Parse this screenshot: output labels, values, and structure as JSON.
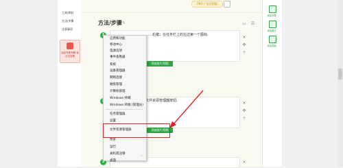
{
  "sidebar": {
    "links": [
      "工具/原料",
      "方法/步骤",
      "注意事项"
    ],
    "badge_text": "百经专属专题 请点击查看"
  },
  "topbar": {
    "ad_text": "PRO 广告位招租"
  },
  "section": {
    "title": "方法/步骤",
    "edit_icon": "✎"
  },
  "steps": [
    {
      "num": "1",
      "text": "……右键；在任务栏上的左边第一个图标:"
    },
    {
      "num": "2",
      "text": "文件资源管理器按钮;"
    },
    {
      "num": "3",
      "text": ""
    }
  ],
  "add_image_label": "添加图片/视频",
  "menu": {
    "items": [
      "应用和功能",
      "移动中心",
      "电源选项",
      "事件查看器",
      "系统",
      "设备管理器",
      "网络连接",
      "磁盘管理",
      "计算机管理",
      "Windows 终端",
      "Windows 终端 (管理员)",
      "任务管理器",
      "设置",
      "文件资源管理器",
      "搜索",
      "运行",
      "关机或注销",
      "桌面"
    ],
    "highlighted": "文件资源管理器",
    "submenu_arrow": "›"
  },
  "rightbar": {
    "items": [
      "添加步骤",
      "添加图片",
      "添加视频"
    ]
  },
  "colors": {
    "accent": "#2da442",
    "highlight": "#e02020",
    "arrow": "#e02020"
  }
}
